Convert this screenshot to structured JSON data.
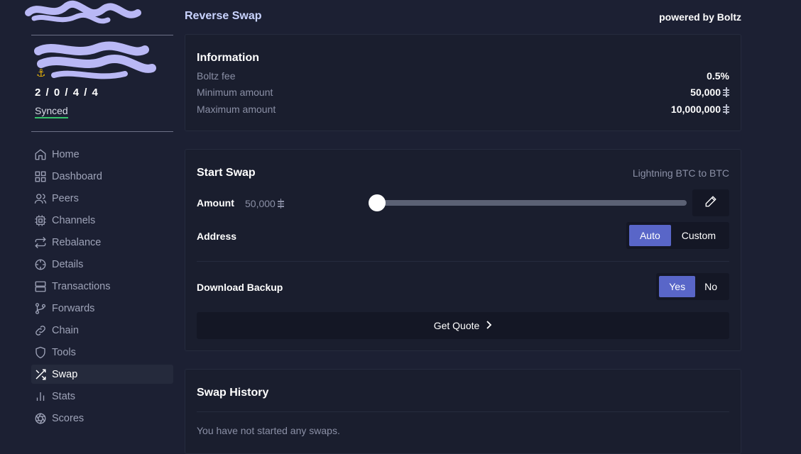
{
  "sidebar": {
    "node_counts": "2 / 0 / 4 / 4",
    "sync_status": "Synced",
    "nav": [
      {
        "label": "Home",
        "icon": "home-icon"
      },
      {
        "label": "Dashboard",
        "icon": "dashboard-icon"
      },
      {
        "label": "Peers",
        "icon": "peers-icon"
      },
      {
        "label": "Channels",
        "icon": "chip-icon"
      },
      {
        "label": "Rebalance",
        "icon": "repeat-icon"
      },
      {
        "label": "Details",
        "icon": "crosshair-icon"
      },
      {
        "label": "Transactions",
        "icon": "server-icon"
      },
      {
        "label": "Forwards",
        "icon": "git-branch-icon"
      },
      {
        "label": "Chain",
        "icon": "link-icon"
      },
      {
        "label": "Tools",
        "icon": "shield-icon"
      },
      {
        "label": "Swap",
        "icon": "shuffle-icon",
        "active": true
      },
      {
        "label": "Stats",
        "icon": "bar-chart-icon"
      },
      {
        "label": "Scores",
        "icon": "aperture-icon"
      }
    ]
  },
  "main": {
    "title": "Reverse Swap",
    "powered_by": "powered by Boltz",
    "information": {
      "title": "Information",
      "rows": [
        {
          "label": "Boltz fee",
          "value": "0.5%",
          "sats": false
        },
        {
          "label": "Minimum amount",
          "value": "50,000",
          "sats": true
        },
        {
          "label": "Maximum amount",
          "value": "10,000,000",
          "sats": true
        }
      ]
    },
    "start_swap": {
      "title": "Start Swap",
      "subtitle": "Lightning BTC to BTC",
      "amount_label": "Amount",
      "amount_value": "50,000",
      "slider_fraction": 0.0,
      "address_label": "Address",
      "address_options": [
        "Auto",
        "Custom"
      ],
      "address_selected": "Auto",
      "backup_label": "Download Backup",
      "backup_options": [
        "Yes",
        "No"
      ],
      "backup_selected": "Yes",
      "quote_button": "Get Quote"
    },
    "history": {
      "title": "Swap History",
      "empty_message": "You have not started any swaps."
    }
  },
  "colors": {
    "background": "#1c2033",
    "card": "#1a1e2e",
    "accent": "#5966c8",
    "synced": "#35c46a",
    "title": "#c9d3ff"
  }
}
